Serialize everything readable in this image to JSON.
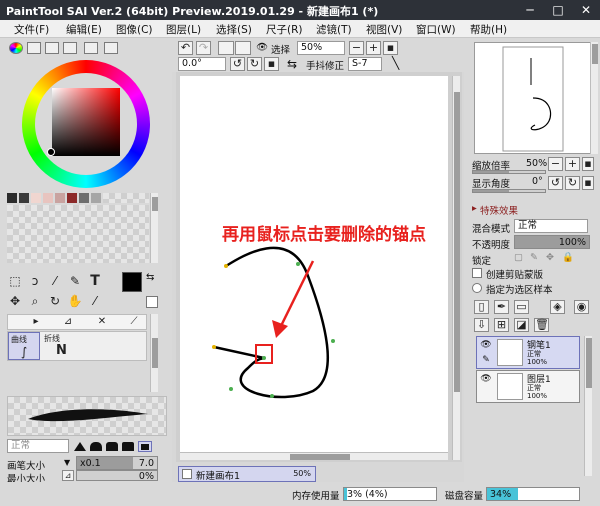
{
  "window": {
    "title": "PaintTool SAI Ver.2 (64bit) Preview.2019.01.29 - 新建画布1 (*)",
    "controls": [
      "─",
      "□",
      "✕"
    ]
  },
  "menu": [
    "文件(F)",
    "编辑(E)",
    "图像(C)",
    "图层(L)",
    "选择(S)",
    "尺子(R)",
    "滤镜(T)",
    "视图(V)",
    "窗口(W)",
    "帮助(H)"
  ],
  "toolbar": {
    "select_label": "选择",
    "zoom": "50%",
    "angle": "0.0°",
    "stabilizer_label": "手抖修正",
    "stabilizer_value": "S-7"
  },
  "tools": {
    "sub_labels": [
      "曲线",
      "折线"
    ],
    "brush_mode": "正常",
    "brush_size_label": "画笔大小",
    "brush_size_mult": "x0.1",
    "brush_size_value": "7.0",
    "min_size_label": "最小大小",
    "min_size_value": "0%"
  },
  "annotation": "再用鼠标点击要删除的锚点",
  "navigator": {
    "zoom_label": "缩放倍率",
    "zoom_value": "50%",
    "angle_label": "显示角度",
    "angle_value": "0°"
  },
  "layers_panel": {
    "effects_label": "特殊效果",
    "blend_label": "混合模式",
    "blend_value": "正常",
    "opacity_label": "不透明度",
    "opacity_value": "100%",
    "opacity_fraction": 1.0,
    "lock_label": "锁定",
    "clip_label": "创建剪贴蒙版",
    "selection_source_label": "指定为选区样本",
    "layers": [
      {
        "name": "钢笔1",
        "mode": "正常",
        "opacity": "100%",
        "selected": true
      },
      {
        "name": "图层1",
        "mode": "正常",
        "opacity": "100%",
        "selected": false
      }
    ]
  },
  "canvas_tab": {
    "name": "新建画布1",
    "zoom": "50%"
  },
  "status": {
    "memory_label": "内存使用量",
    "memory_value": "3% (4%)",
    "memory_fraction": 0.03,
    "disk_label": "磁盘容量",
    "disk_value": "34%",
    "disk_fraction": 0.34
  },
  "colors": {
    "accent": "#e8211e",
    "titlebar": "#2d3138",
    "selected_layer": "#d6d9f2"
  },
  "palette": [
    "#2b2b2b",
    "#3a3a3a",
    "#f0d6d0",
    "#e8c4bf",
    "#c9a3a0",
    "#8c2a2a",
    "#6d6d6d",
    "#a6a6a6"
  ]
}
